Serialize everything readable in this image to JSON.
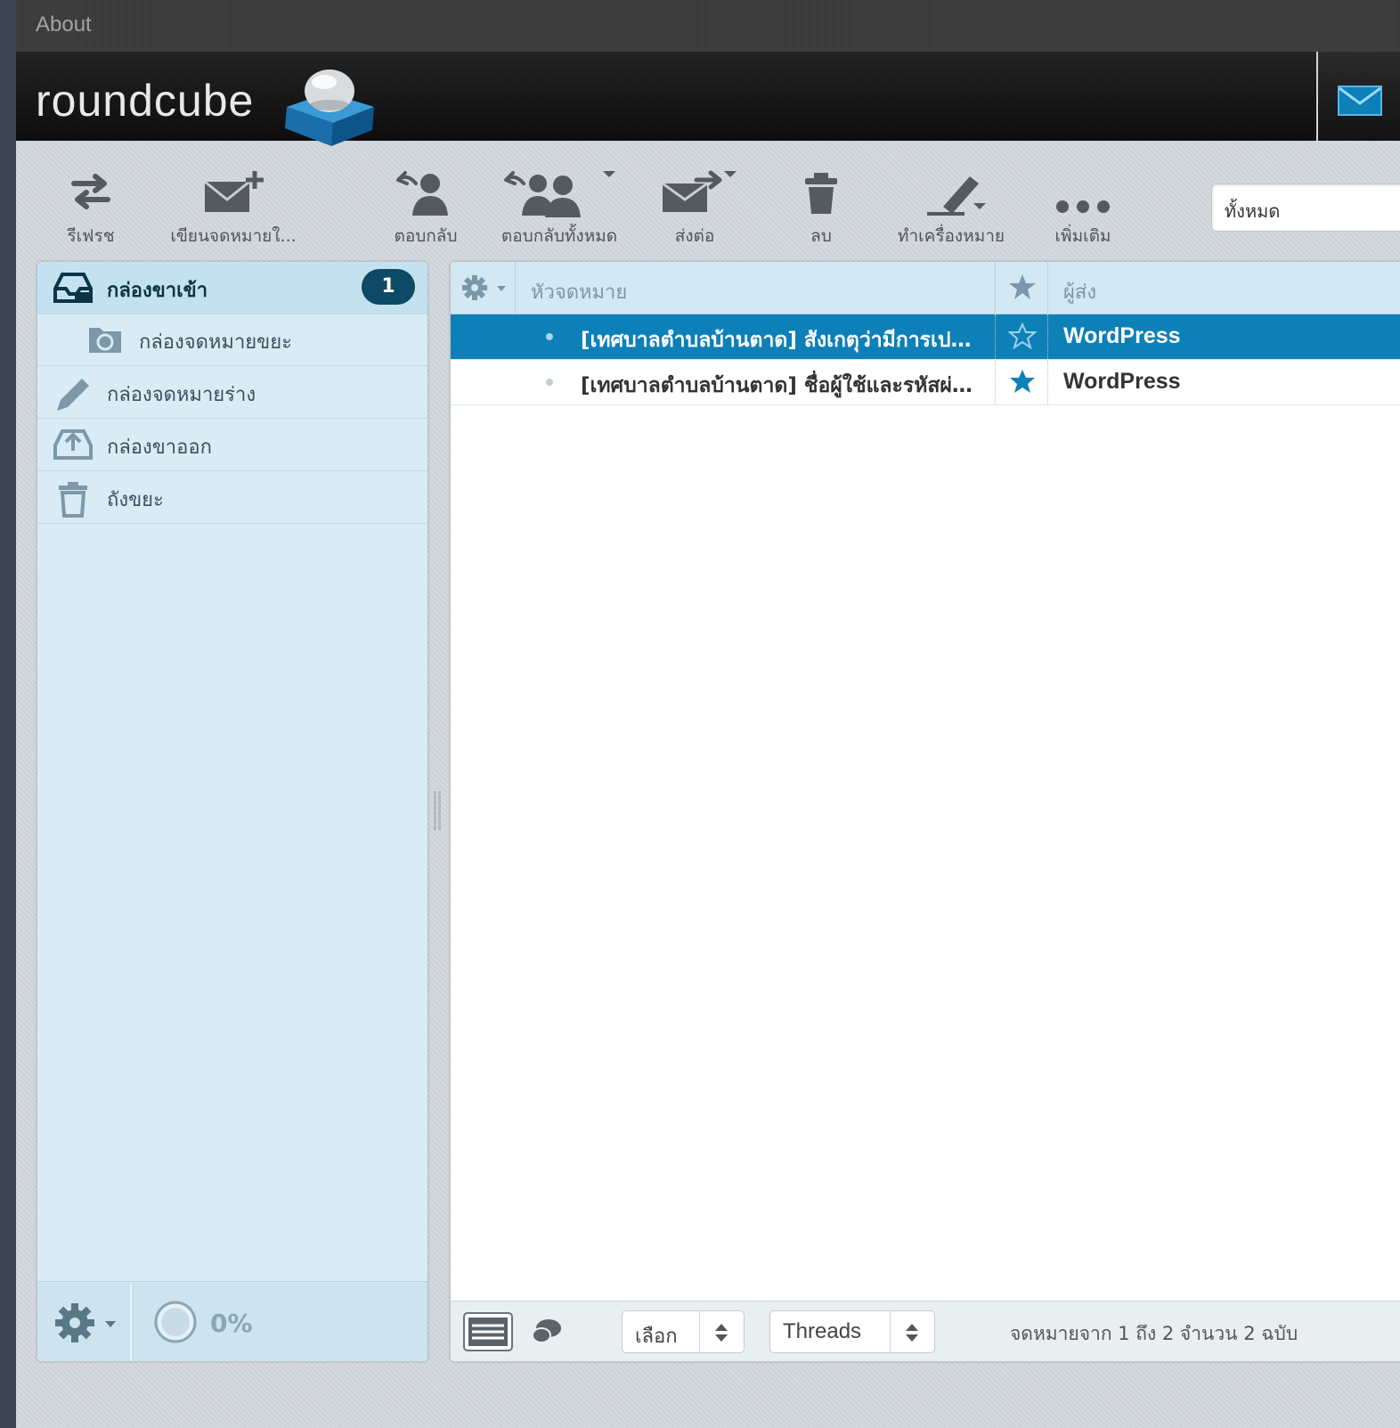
{
  "topnav": {
    "about": "About"
  },
  "header": {
    "logo_text": "roundcube"
  },
  "toolbar": {
    "refresh": "รีเฟรช",
    "compose": "เขียนจดหมายใ...",
    "reply": "ตอบกลับ",
    "reply_all": "ตอบกลับทั้งหมด",
    "forward": "ส่งต่อ",
    "delete": "ลบ",
    "mark": "ทำเครื่องหมาย",
    "more": "เพิ่มเติม"
  },
  "search": {
    "filter_value": "ทั้งหมด"
  },
  "folders": {
    "items": [
      {
        "name": "กล่องขาเข้า",
        "count": "1"
      },
      {
        "name": "กล่องจดหมายขยะ"
      },
      {
        "name": "กล่องจดหมายร่าง"
      },
      {
        "name": "กล่องขาออก"
      },
      {
        "name": "ถังขยะ"
      }
    ],
    "quota": "0%"
  },
  "list": {
    "columns": {
      "subject": "หัวจดหมาย",
      "from": "ผู้ส่ง"
    },
    "rows": [
      {
        "subject": "[เทศบาลตำบลบ้านตาด] สังเกตุว่ามีการเปลี่ยนแปลงรหัสผ่าน",
        "from": "WordPress",
        "flagged": false
      },
      {
        "subject": "[เทศบาลตำบลบ้านตาด] ชื่อผู้ใช้และรหัสผ่านของคุณ",
        "from": "WordPress",
        "flagged": true
      }
    ]
  },
  "footer": {
    "select_label": "เลือก",
    "threads_label": "Threads",
    "count_text": "จดหมายจาก 1 ถึง 2 จำนวน 2 ฉบับ"
  },
  "colors": {
    "accent": "#0d80b8",
    "badge": "#0c4a65",
    "folder_bg": "#d9ecf5"
  }
}
